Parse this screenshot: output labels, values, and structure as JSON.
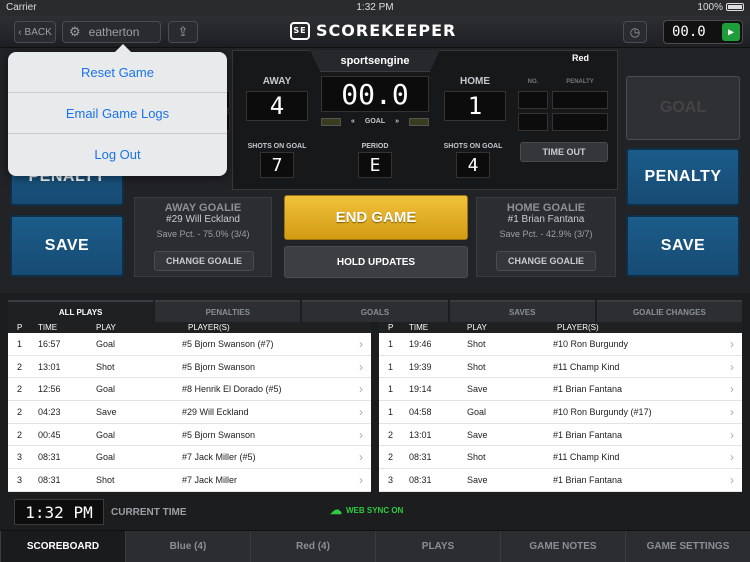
{
  "status_bar": {
    "carrier": "Carrier",
    "time": "1:32 PM",
    "battery": "100%"
  },
  "topbar": {
    "back_label": "BACK",
    "username": "eatherton",
    "logo_badge": "SE",
    "logo_text": "SCOREKEEPER",
    "game_clock": "00.0"
  },
  "scoreboard": {
    "brand": "sportsengine",
    "red_label": "Red",
    "away_label": "AWAY",
    "home_label": "HOME",
    "away_score": "4",
    "home_score": "1",
    "clock": "00.0",
    "goal_label": "GOAL",
    "no_label": "NO.",
    "penalty_label": "PENALTY",
    "shots_label": "SHOTS ON GOAL",
    "period_label": "PERIOD",
    "away_shots": "7",
    "home_shots": "4",
    "period": "E",
    "time_out": "TIME OUT"
  },
  "buttons": {
    "penalty_left": "PENALTY",
    "save_left": "SAVE",
    "goal_right": "GOAL",
    "penalty_right": "PENALTY",
    "save_right": "SAVE",
    "end_game": "END GAME",
    "hold_updates": "HOLD UPDATES"
  },
  "away_goalie": {
    "title": "AWAY GOALIE",
    "name": "#29 Will Eckland",
    "save_pct": "Save Pct. - 75.0% (3/4)",
    "change": "CHANGE GOALIE"
  },
  "home_goalie": {
    "title": "HOME GOALIE",
    "name": "#1 Brian Fantana",
    "save_pct": "Save Pct. - 42.9% (3/7)",
    "change": "CHANGE GOALIE"
  },
  "filter_tabs": [
    "ALL PLAYS",
    "PENALTIES",
    "GOALS",
    "SAVES",
    "GOALIE CHANGES"
  ],
  "table_headers": {
    "p": "P",
    "time": "TIME",
    "play": "PLAY",
    "players": "PLAYER(S)"
  },
  "left_plays": [
    {
      "p": "1",
      "time": "16:57",
      "play": "Goal",
      "players": "#5 Bjorn Swanson  (#7)"
    },
    {
      "p": "2",
      "time": "13:01",
      "play": "Shot",
      "players": "#5 Bjorn Swanson"
    },
    {
      "p": "2",
      "time": "12:56",
      "play": "Goal",
      "players": "#8 Henrik El Dorado  (#5)"
    },
    {
      "p": "2",
      "time": "04:23",
      "play": "Save",
      "players": "#29 Will Eckland"
    },
    {
      "p": "2",
      "time": "00:45",
      "play": "Goal",
      "players": "#5 Bjorn Swanson"
    },
    {
      "p": "3",
      "time": "08:31",
      "play": "Goal",
      "players": "#7 Jack Miller  (#5)"
    },
    {
      "p": "3",
      "time": "08:31",
      "play": "Shot",
      "players": "#7 Jack Miller"
    }
  ],
  "right_plays": [
    {
      "p": "1",
      "time": "19:46",
      "play": "Shot",
      "players": "#10 Ron Burgundy"
    },
    {
      "p": "1",
      "time": "19:39",
      "play": "Shot",
      "players": "#11 Champ Kind"
    },
    {
      "p": "1",
      "time": "19:14",
      "play": "Save",
      "players": "#1 Brian Fantana"
    },
    {
      "p": "1",
      "time": "04:58",
      "play": "Goal",
      "players": "#10 Ron Burgundy  (#17)"
    },
    {
      "p": "2",
      "time": "13:01",
      "play": "Save",
      "players": "#1 Brian Fantana"
    },
    {
      "p": "2",
      "time": "08:31",
      "play": "Shot",
      "players": "#11 Champ Kind"
    },
    {
      "p": "3",
      "time": "08:31",
      "play": "Save",
      "players": "#1 Brian Fantana"
    }
  ],
  "footer": {
    "current_time": "1:32 PM",
    "current_time_label": "CURRENT TIME",
    "web_sync": "WEB SYNC ON"
  },
  "bottom_tabs": [
    "SCOREBOARD",
    "Blue (4)",
    "Red (4)",
    "PLAYS",
    "GAME NOTES",
    "GAME SETTINGS"
  ],
  "popover_menu": [
    "Reset Game",
    "Email Game Logs",
    "Log Out"
  ],
  "colors": {
    "accent_blue": "#1b5c8a",
    "end_game_gold": "#e0a81c",
    "sync_green": "#2ecc40",
    "play_green": "#1e9d3a"
  }
}
